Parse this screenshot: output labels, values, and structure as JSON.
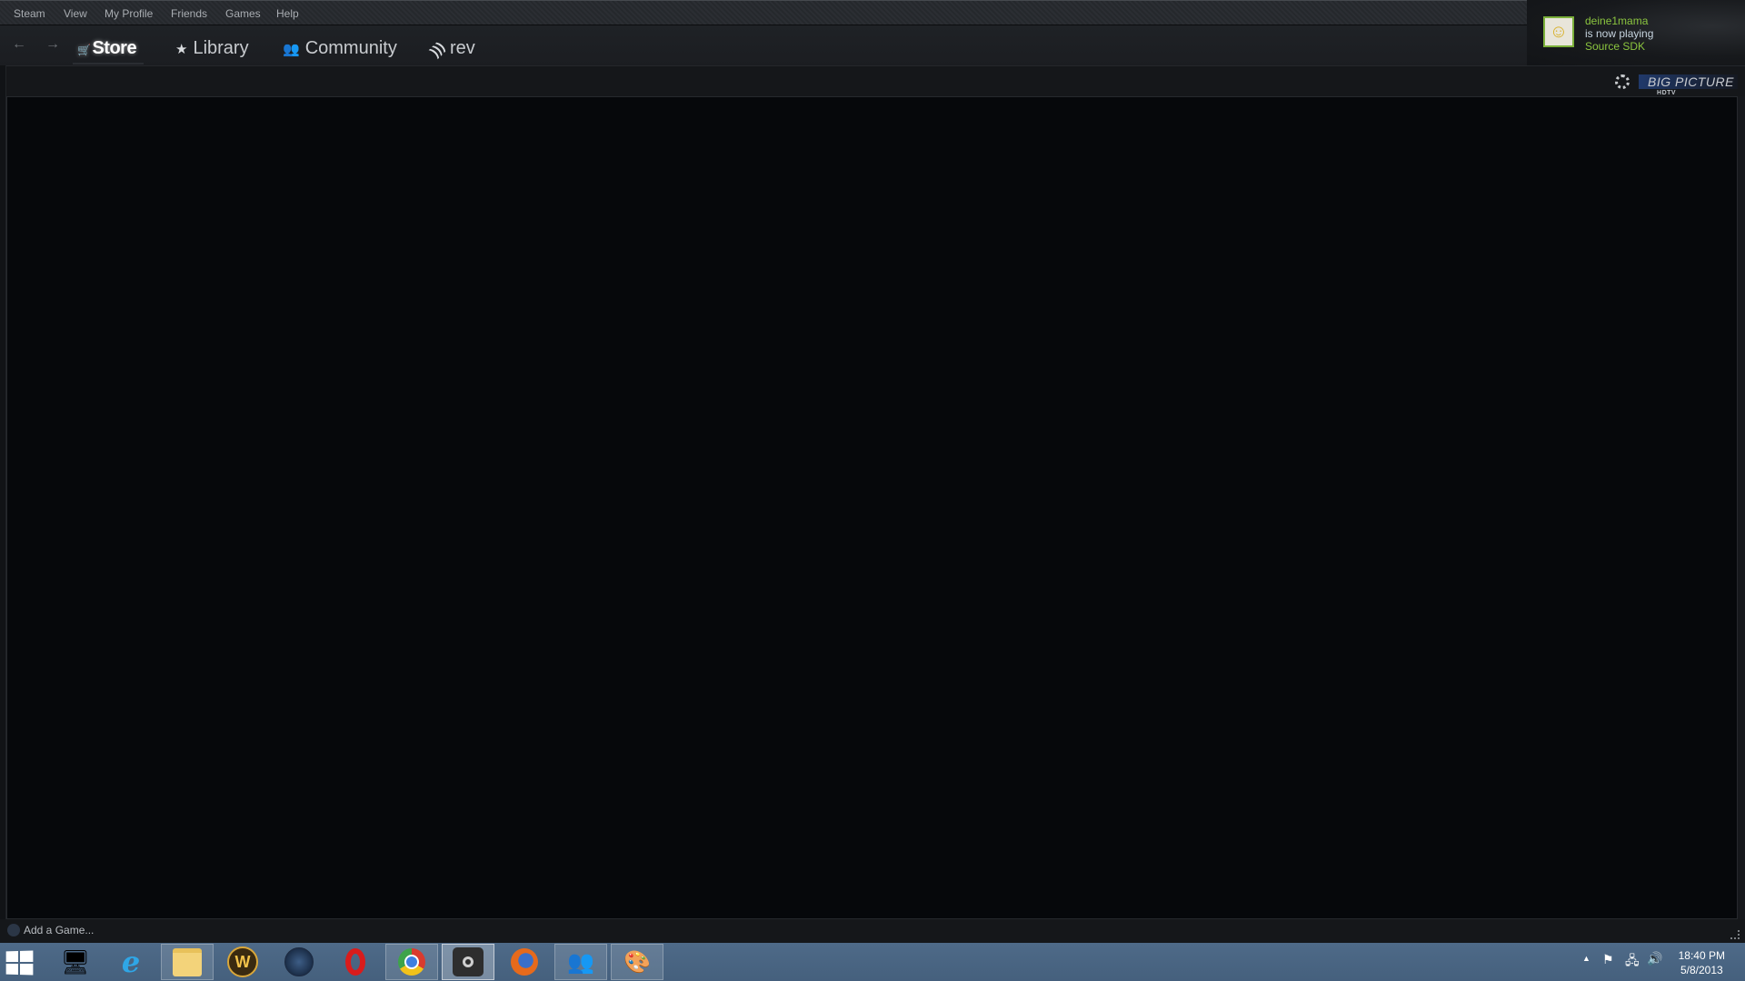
{
  "menu": {
    "items": [
      "Steam",
      "View",
      "My Profile",
      "Friends",
      "Games",
      "Help"
    ]
  },
  "nav": {
    "back_icon": "arrow-left-icon",
    "forward_icon": "arrow-right-icon",
    "tabs": [
      {
        "label": "Store",
        "icon": "cart-icon",
        "glyph": "🛒",
        "active": true
      },
      {
        "label": "Library",
        "icon": "star-icon",
        "glyph": "★",
        "active": false
      },
      {
        "label": "Community",
        "icon": "people-icon",
        "glyph": "👥",
        "active": false
      },
      {
        "label": "rev",
        "icon": "rss-icon",
        "glyph": "⊃",
        "active": false
      }
    ]
  },
  "notification": {
    "username": "deine1mama",
    "status": "is now playing",
    "game": "Source SDK",
    "name_color": "#8bc53f",
    "status_color": "#c6d4df"
  },
  "big_picture": {
    "label": "BIG PICTURE",
    "sub": "HDTV"
  },
  "footer": {
    "add_game": "Add a Game..."
  },
  "taskbar": {
    "apps": [
      {
        "name": "computer",
        "glyph": "🖥",
        "state": "pinned"
      },
      {
        "name": "internet-explorer",
        "glyph": "e",
        "state": "pinned"
      },
      {
        "name": "file-explorer",
        "glyph": "📁",
        "state": "open"
      },
      {
        "name": "world-of-warcraft",
        "glyph": "W",
        "state": "pinned"
      },
      {
        "name": "starcraft-2",
        "glyph": "◉",
        "state": "pinned"
      },
      {
        "name": "opera",
        "glyph": "O",
        "state": "pinned"
      },
      {
        "name": "chrome",
        "glyph": "◎",
        "state": "open"
      },
      {
        "name": "steam",
        "glyph": "♨",
        "state": "active"
      },
      {
        "name": "firefox",
        "glyph": "🦊",
        "state": "pinned"
      },
      {
        "name": "messenger",
        "glyph": "👥",
        "state": "open"
      },
      {
        "name": "paint",
        "glyph": "🎨",
        "state": "open"
      }
    ],
    "time": "18:40 PM",
    "date": "5/8/2013"
  }
}
